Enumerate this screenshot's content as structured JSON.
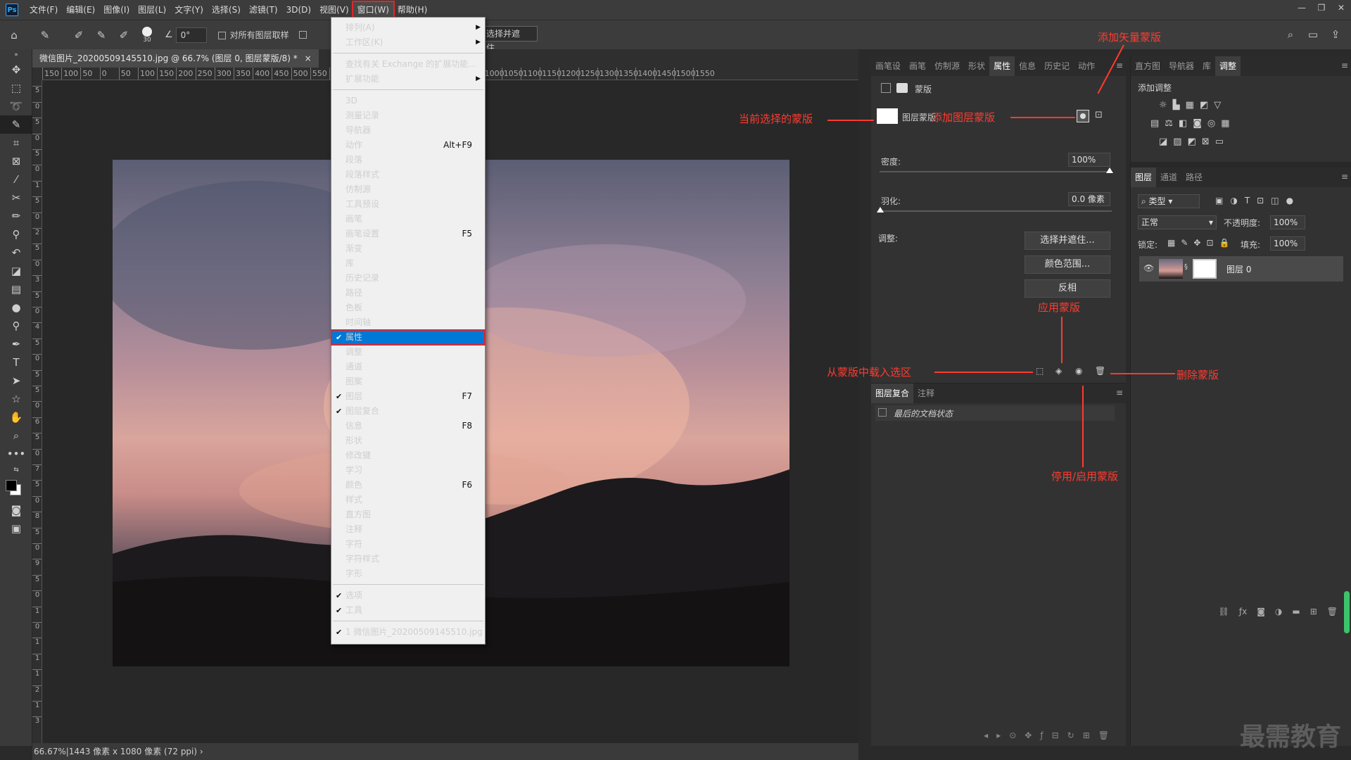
{
  "menubar": {
    "logo": "Ps",
    "items": [
      "文件(F)",
      "编辑(E)",
      "图像(I)",
      "图层(L)",
      "文字(Y)",
      "选择(S)",
      "滤镜(T)",
      "3D(D)",
      "视图(V)",
      "窗口(W)",
      "帮助(H)"
    ],
    "active_index": 9,
    "window_controls": [
      "—",
      "❐",
      "✕"
    ]
  },
  "options_bar": {
    "angle_value": "0°",
    "brush_size": "30",
    "sample_all_layers": "对所有图层取样",
    "select_mask_button": "选择并遮住..."
  },
  "document": {
    "tab_title": "微信图片_20200509145510.jpg @ 66.7% (图层 0, 图层蒙版/8) *",
    "tab_close": "×",
    "status": "66.67%|1443 像素 x 1080 像素 (72 ppi)",
    "ruler_h": [
      "150",
      "100",
      "50",
      "0",
      "50",
      "100",
      "150",
      "200",
      "250",
      "300",
      "350",
      "400",
      "450",
      "500",
      "550",
      "600",
      "650",
      "700",
      "750",
      "800",
      "850",
      "900",
      "950",
      "1000",
      "1050",
      "1100",
      "1150",
      "1200",
      "1250",
      "1300",
      "1350",
      "1400",
      "1450",
      "1500",
      "1550"
    ],
    "ruler_v": [
      "0",
      "5",
      "0",
      "5",
      "0",
      "5",
      "0",
      "1",
      "5",
      "0",
      "2",
      "5",
      "0",
      "3",
      "5",
      "0",
      "4",
      "5",
      "0",
      "5",
      "5",
      "0",
      "6",
      "5",
      "0",
      "7",
      "5",
      "0",
      "8",
      "5",
      "0",
      "9",
      "5",
      "0",
      "1",
      "0",
      "1",
      "1",
      "1",
      "2",
      "1",
      "3"
    ]
  },
  "window_menu": {
    "items": [
      {
        "label": "排列(A)",
        "submenu": true
      },
      {
        "label": "工作区(K)",
        "submenu": true
      },
      {
        "sep": true
      },
      {
        "label": "查找有关 Exchange 的扩展功能..."
      },
      {
        "label": "扩展功能",
        "submenu": true
      },
      {
        "sep": true
      },
      {
        "label": "3D"
      },
      {
        "label": "测量记录"
      },
      {
        "label": "导航器"
      },
      {
        "label": "动作",
        "shortcut": "Alt+F9"
      },
      {
        "label": "段落"
      },
      {
        "label": "段落样式"
      },
      {
        "label": "仿制源"
      },
      {
        "label": "工具预设"
      },
      {
        "label": "画笔"
      },
      {
        "label": "画笔设置",
        "shortcut": "F5"
      },
      {
        "label": "渐变"
      },
      {
        "label": "库"
      },
      {
        "label": "历史记录"
      },
      {
        "label": "路径"
      },
      {
        "label": "色板"
      },
      {
        "label": "时间轴"
      },
      {
        "label": "属性",
        "checked": true,
        "selected": true
      },
      {
        "label": "调整"
      },
      {
        "label": "通道"
      },
      {
        "label": "图案"
      },
      {
        "label": "图层",
        "checked": true,
        "shortcut": "F7"
      },
      {
        "label": "图层复合",
        "checked": true
      },
      {
        "label": "信息",
        "shortcut": "F8"
      },
      {
        "label": "形状"
      },
      {
        "label": "修改键"
      },
      {
        "label": "学习"
      },
      {
        "label": "颜色",
        "shortcut": "F6"
      },
      {
        "label": "样式"
      },
      {
        "label": "直方图"
      },
      {
        "label": "注释"
      },
      {
        "label": "字符"
      },
      {
        "label": "字符样式"
      },
      {
        "label": "字形"
      },
      {
        "sep": true
      },
      {
        "label": "选项",
        "checked": true
      },
      {
        "label": "工具",
        "checked": true
      },
      {
        "sep": true
      },
      {
        "label": "1 微信图片_20200509145510.jpg",
        "checked": true
      }
    ]
  },
  "properties_panel": {
    "tabs": [
      "画笔设",
      "画笔",
      "仿制源",
      "形状",
      "属性",
      "信息",
      "历史记",
      "动作"
    ],
    "active_tab": 4,
    "header": "蒙版",
    "mask_label": "图层蒙版",
    "density_label": "密度:",
    "density_value": "100%",
    "feather_label": "羽化:",
    "feather_value": "0.0 像素",
    "adjust_label": "调整:",
    "btn_select_mask": "选择并遮住...",
    "btn_color_range": "颜色范围...",
    "btn_invert": "反相"
  },
  "layer_comps_panel": {
    "tabs": [
      "图层复合",
      "注释"
    ],
    "row": "最后的文档状态"
  },
  "right_top_panel": {
    "tabs": [
      "直方图",
      "导航器",
      "库",
      "调整"
    ],
    "active_tab": 3,
    "title": "添加调整"
  },
  "layers_panel": {
    "tabs": [
      "图层",
      "通道",
      "路径"
    ],
    "filter_label": "类型",
    "blend_mode": "正常",
    "opacity_label": "不透明度:",
    "opacity_value": "100%",
    "lock_label": "锁定:",
    "fill_label": "填充:",
    "fill_value": "100%",
    "layer_name": "图层 0"
  },
  "annotations": {
    "add_vector_mask": "添加矢量蒙版",
    "current_mask": "当前选择的蒙版",
    "add_layer_mask": "添加图层蒙版",
    "apply_mask": "应用蒙版",
    "load_selection": "从蒙版中载入选区",
    "delete_mask": "删除蒙版",
    "toggle_mask": "停用/启用蒙版"
  },
  "watermark": "最需教育"
}
